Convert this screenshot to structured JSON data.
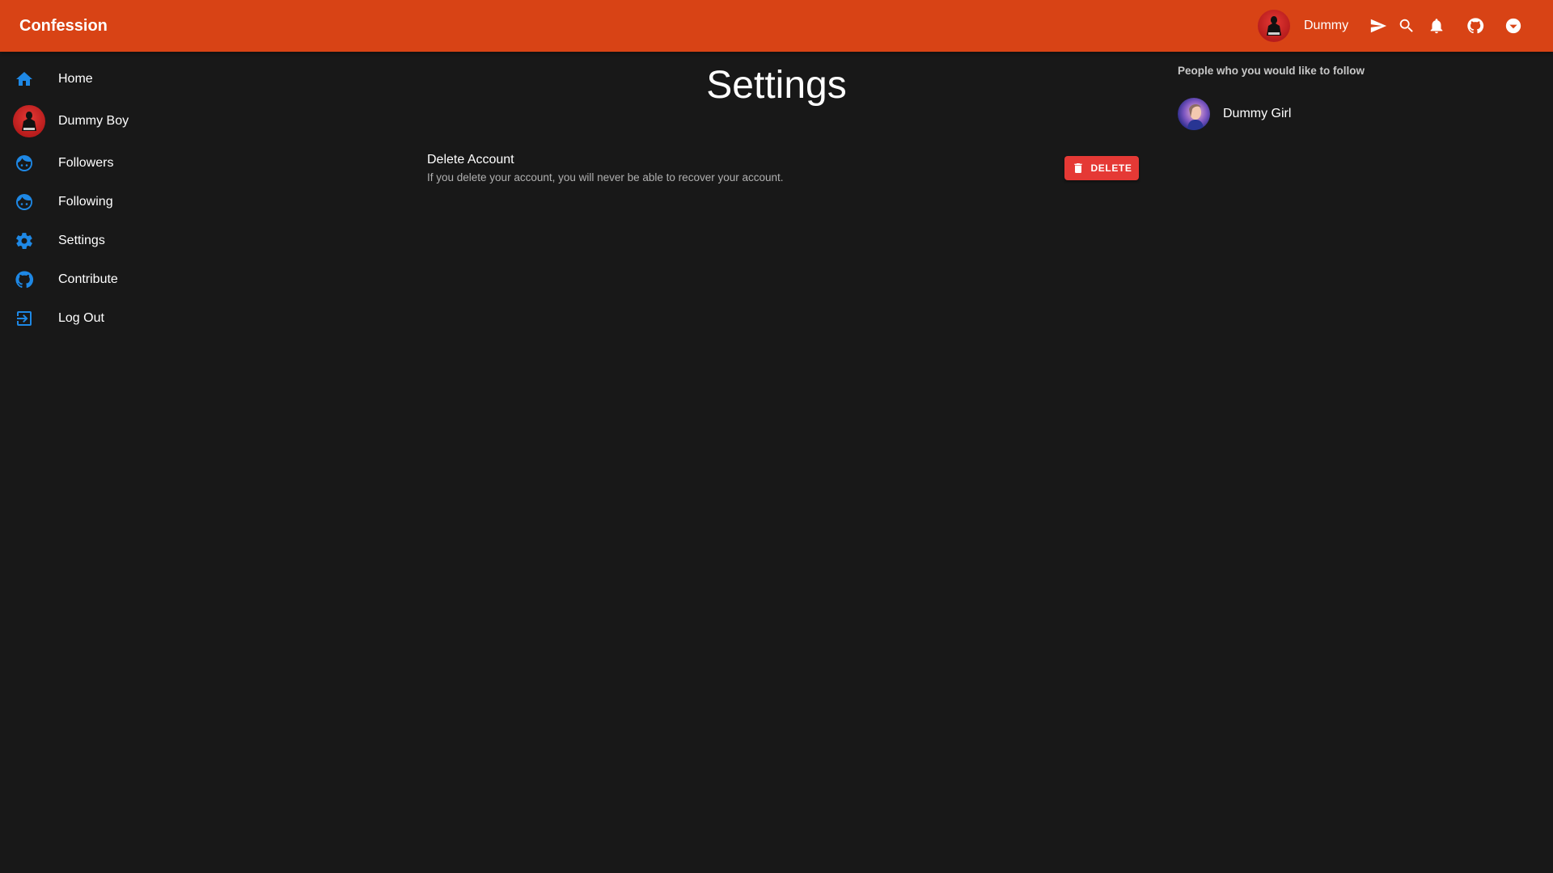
{
  "app": {
    "title": "Confession",
    "accent_color": "#d84315",
    "background_color": "#181818",
    "icon_color": "#1e88e5"
  },
  "topbar": {
    "username": "Dummy",
    "icons": [
      "send-icon",
      "search-icon",
      "bell-icon",
      "github-icon",
      "chevron-down-circle-icon"
    ]
  },
  "sidebar": {
    "items": [
      {
        "label": "Home",
        "icon": "home-icon"
      },
      {
        "label": "Dummy Boy",
        "icon": "avatar"
      },
      {
        "label": "Followers",
        "icon": "face-icon"
      },
      {
        "label": "Following",
        "icon": "face-icon"
      },
      {
        "label": "Settings",
        "icon": "gear-icon"
      },
      {
        "label": "Contribute",
        "icon": "github-icon"
      },
      {
        "label": "Log Out",
        "icon": "logout-icon"
      }
    ]
  },
  "main": {
    "title": "Settings",
    "delete_account": {
      "title": "Delete Account",
      "description": "If you delete your account, you will never be able to recover your account.",
      "button_label": "DELETE",
      "button_color": "#e53935"
    }
  },
  "suggestions": {
    "heading": "People who you would like to follow",
    "people": [
      {
        "name": "Dummy Girl"
      }
    ]
  }
}
